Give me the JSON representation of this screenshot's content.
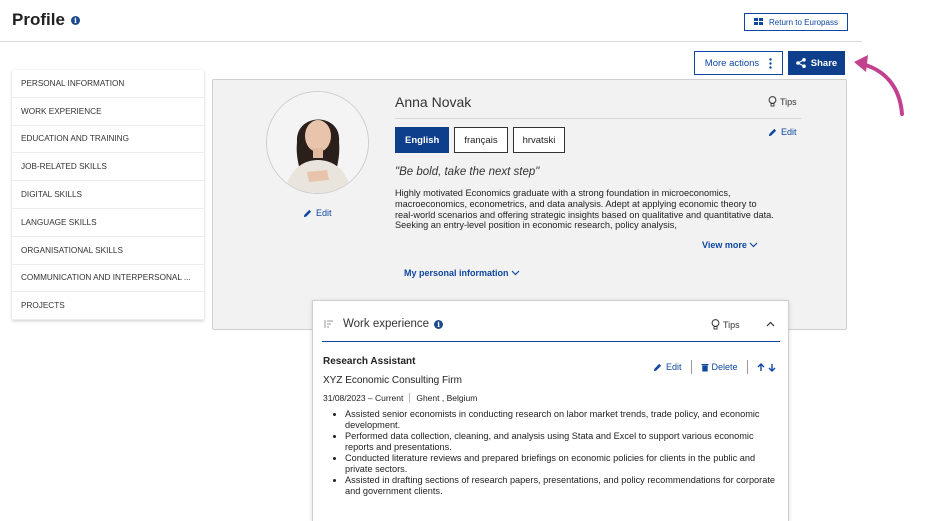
{
  "page": {
    "title": "Profile"
  },
  "toolbar": {
    "return_label": "Return to Europass",
    "more_actions_label": "More actions",
    "share_label": "Share"
  },
  "sidebar": {
    "items": [
      {
        "label": "PERSONAL INFORMATION"
      },
      {
        "label": "WORK EXPERIENCE"
      },
      {
        "label": "EDUCATION AND TRAINING"
      },
      {
        "label": "JOB-RELATED SKILLS"
      },
      {
        "label": "DIGITAL SKILLS"
      },
      {
        "label": "LANGUAGE SKILLS"
      },
      {
        "label": "ORGANISATIONAL SKILLS"
      },
      {
        "label": "COMMUNICATION AND INTERPERSONAL ..."
      },
      {
        "label": "PROJECTS"
      }
    ]
  },
  "profile": {
    "name": "Anna Novak",
    "tips_label": "Tips",
    "edit_label": "Edit",
    "photo_edit_label": "Edit",
    "languages": [
      {
        "label": "English",
        "active": true
      },
      {
        "label": "français",
        "active": false
      },
      {
        "label": "hrvatski",
        "active": false
      }
    ],
    "motto": "\"Be bold, take the next step\"",
    "summary": "Highly motivated Economics graduate with a strong foundation in microeconomics, macroeconomics, econometrics, and data analysis. Adept at applying economic theory to real-world scenarios and offering strategic insights based on qualitative and quantitative data. Seeking an entry-level position in economic research, policy analysis,",
    "view_more_label": "View more",
    "personal_info_label": "My personal information"
  },
  "work": {
    "section_title": "Work experience",
    "tips_label": "Tips",
    "job": {
      "title": "Research Assistant",
      "company": "XYZ Economic Consulting Firm",
      "dates": "31/08/2023 – Current",
      "location": "Ghent , Belgium",
      "edit_label": "Edit",
      "delete_label": "Delete",
      "bullets": [
        "Assisted senior economists in conducting research on labor market trends, trade policy, and economic development.",
        "Performed data collection, cleaning, and analysis using Stata and Excel to support various economic reports and presentations.",
        "Conducted literature reviews and prepared briefings on economic policies for clients in the public and private sectors.",
        "Assisted in drafting sections of research papers, presentations, and policy recommendations for corporate and government clients."
      ]
    }
  },
  "colors": {
    "primary": "#0e3f8c",
    "annotation_arrow": "#c2418f",
    "card_bg": "#f2f2f2"
  },
  "icons": {
    "info": "info-icon",
    "grid": "grid-icon",
    "kebab": "kebab-icon",
    "share": "share-icon",
    "pencil": "pencil-icon",
    "lightbulb": "lightbulb-icon",
    "trash": "trash-icon",
    "chevron": "chevron-icon",
    "arrows": "arrow-up-down-icon"
  }
}
